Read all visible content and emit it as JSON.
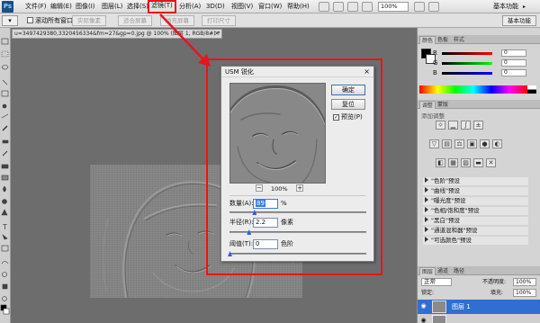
{
  "app": {
    "logo": "Ps"
  },
  "menubar": {
    "items": [
      {
        "id": "file",
        "label": "文件(F)"
      },
      {
        "id": "edit",
        "label": "编辑(E)"
      },
      {
        "id": "image",
        "label": "图像(I)"
      },
      {
        "id": "layer",
        "label": "图层(L)"
      },
      {
        "id": "select",
        "label": "选择(S)"
      },
      {
        "id": "filter",
        "label": "滤镜(T)"
      },
      {
        "id": "analysis",
        "label": "分析(A)"
      },
      {
        "id": "3d",
        "label": "3D(D)"
      },
      {
        "id": "view",
        "label": "视图(V)"
      },
      {
        "id": "window",
        "label": "窗口(W)"
      },
      {
        "id": "help",
        "label": "帮助(H)"
      }
    ],
    "zoom": "100%",
    "workspace": "基本功能"
  },
  "optionsbar": {
    "scroll_all_windows": "滚动所有窗口",
    "actual_pixels": "实际像素",
    "fit_screen": "适合屏幕",
    "fill_screen": "填充屏幕",
    "print_size": "打印尺寸"
  },
  "document": {
    "tab_title": "u=3497429380,3320456334&fm=27&gp=0.jpg @ 100% (图层 1, RGB/8#) *",
    "close": "×"
  },
  "dialog": {
    "title": "USM 锐化",
    "close": "×",
    "ok": "确定",
    "reset": "复位",
    "preview_label": "预览(P)",
    "preview_checked": "✓",
    "zoom_out": "−",
    "zoom_in": "+",
    "zoom_percent": "100%",
    "amount": {
      "label": "数量(A):",
      "value": "89",
      "unit": "%",
      "level": 0.18
    },
    "radius": {
      "label": "半径(R):",
      "value": "2.2",
      "unit": "像素",
      "level": 0.14
    },
    "threshold": {
      "label": "阈值(T):",
      "value": "0",
      "unit": "色阶",
      "level": 0.0
    }
  },
  "colors_panel": {
    "tabs": [
      "颜色",
      "色板",
      "样式"
    ],
    "r": "R",
    "g": "G",
    "b": "B",
    "r_value": "0",
    "g_value": "0",
    "b_value": "0"
  },
  "adjustments_panel": {
    "tabs": [
      "调整",
      "蒙版"
    ],
    "subtitle": "添加调整",
    "presets": [
      "\"色阶\"预设",
      "\"曲线\"预设",
      "\"曝光度\"预设",
      "\"色相/饱和度\"预设",
      "\"黑白\"预设",
      "\"通道混和器\"预设",
      "\"可选颜色\"预设"
    ]
  },
  "layers_panel": {
    "tabs": [
      "图层",
      "通道",
      "路径"
    ],
    "blend_mode": "正常",
    "opacity_label": "不透明度:",
    "opacity": "100%",
    "lock_label": "锁定:",
    "fill_label": "填充:",
    "fill": "100%",
    "layers": [
      {
        "name": "图层 1"
      }
    ]
  },
  "colors": {
    "accent_red": "#e8141a",
    "selection_blue": "#2f6fd1"
  }
}
